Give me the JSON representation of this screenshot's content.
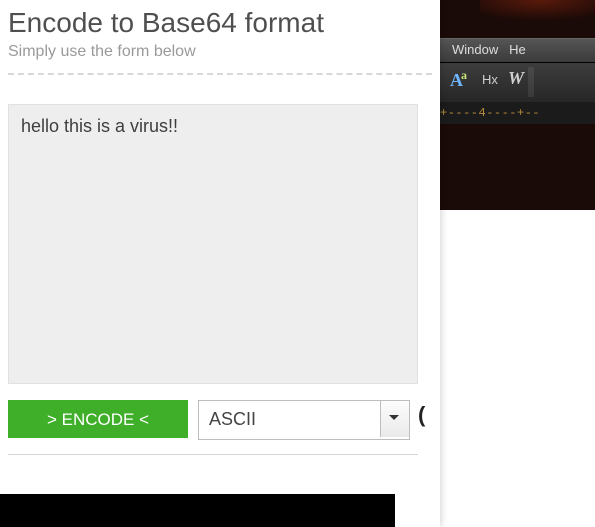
{
  "header": {
    "title": "Encode to Base64 format",
    "subtitle": "Simply use the form below"
  },
  "input": {
    "text": "hello this is a virus!!"
  },
  "actions": {
    "encode_label": "> ENCODE <"
  },
  "charset": {
    "selected": "ASCII"
  },
  "paren": "(",
  "output": {
    "tail": "="
  },
  "hex_editor": {
    "menu": {
      "window": "Window",
      "help_fragment": "He"
    },
    "toolbar": {
      "aa": "A",
      "aa_sup": "a",
      "hx": "Hx",
      "w": "W"
    },
    "ruler": "+----4----+--"
  }
}
